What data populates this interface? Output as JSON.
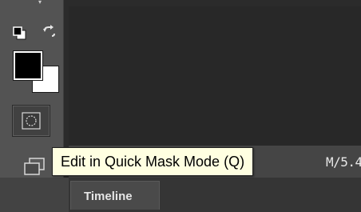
{
  "status_bar": {
    "doc_info": "M/5.4"
  },
  "tooltip": {
    "text": "Edit in Quick Mask Mode (Q)"
  },
  "bottom_panel": {
    "tabs": [
      {
        "label": "Timeline"
      }
    ]
  },
  "tools": {
    "foreground_color": "#000000",
    "background_color": "#ffffff",
    "icons": [
      "default-colors-icon",
      "swap-colors-icon",
      "quick-mask-icon",
      "screen-mode-icon"
    ]
  },
  "colors": {
    "panel_bg": "#535353",
    "canvas_bg": "#282828",
    "tooltip_bg": "#ffffe1"
  }
}
